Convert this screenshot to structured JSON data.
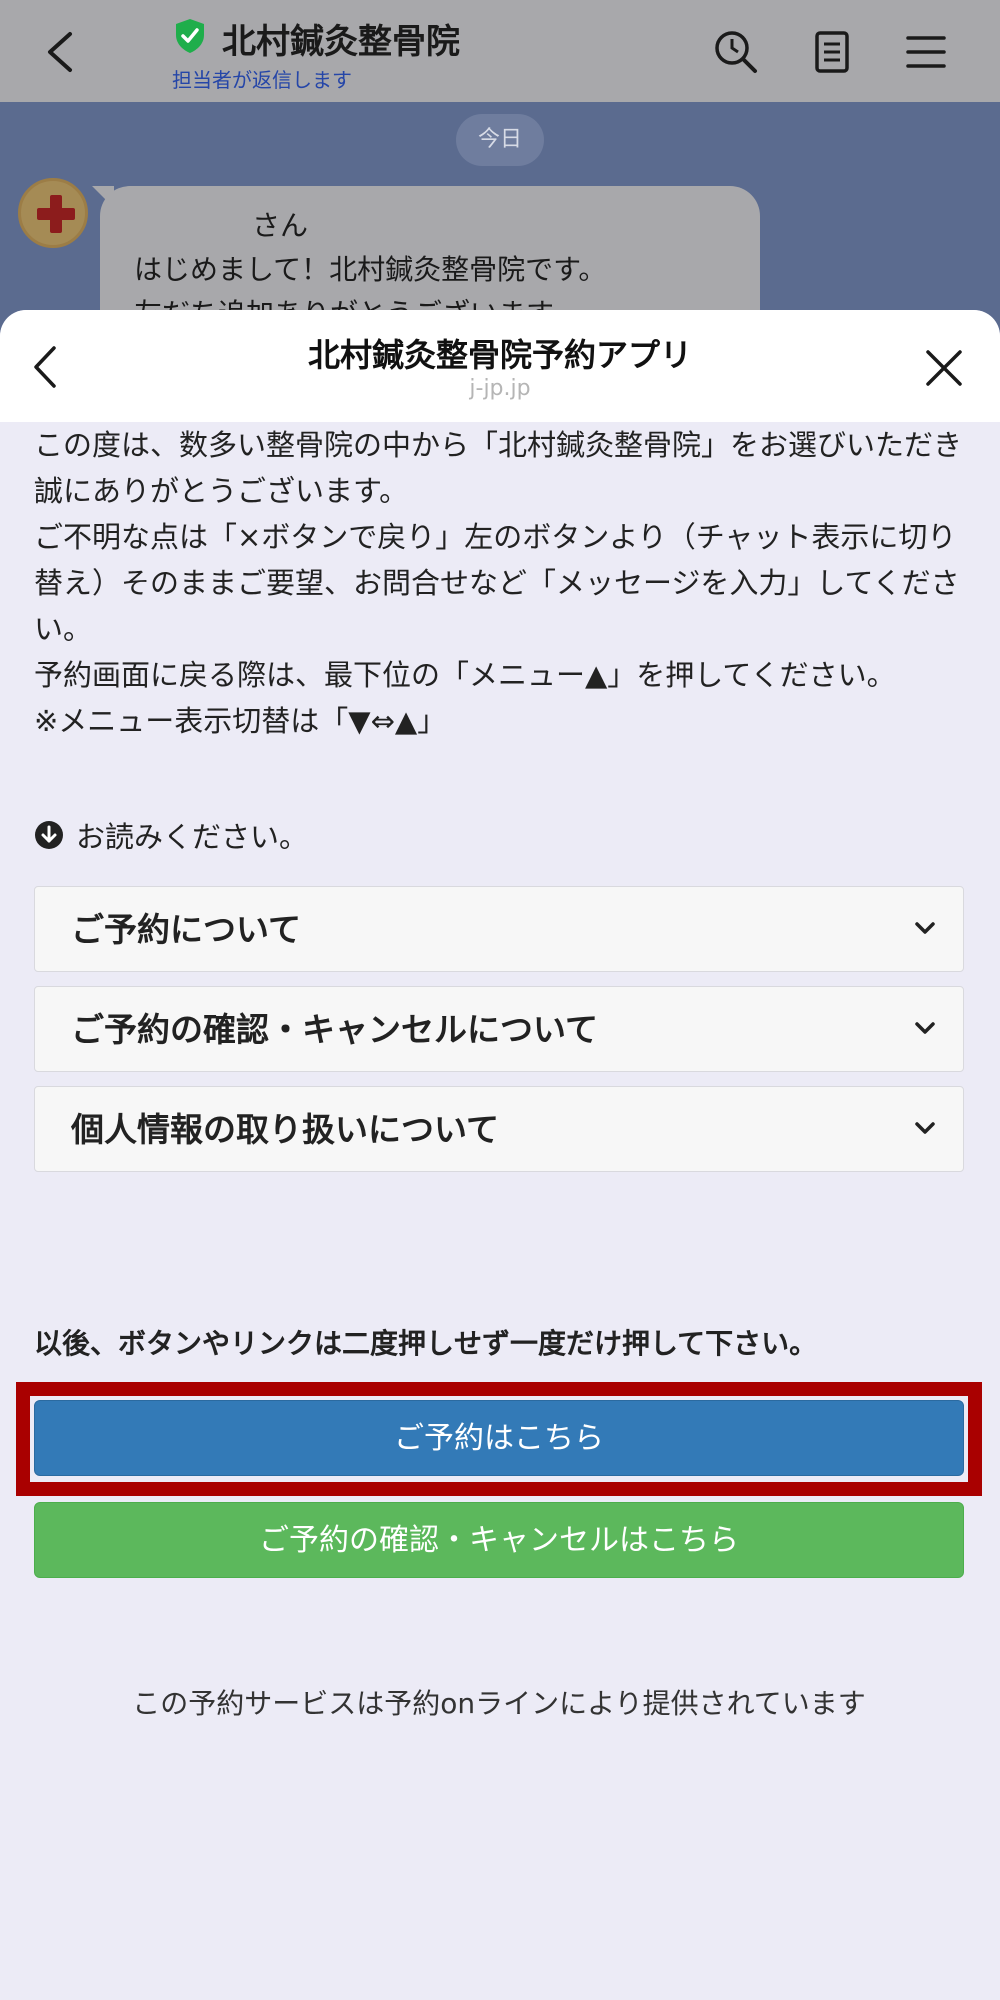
{
  "chat": {
    "title": "北村鍼灸整骨院",
    "subtitle": "担当者が返信します",
    "date_chip": "今日",
    "bubble": {
      "line1": "さん",
      "line2": "はじめまして！北村鍼灸整骨院です。",
      "line3": "友だち追加ありがとうございます。"
    }
  },
  "sheet": {
    "title": "北村鍼灸整骨院予約アプリ",
    "domain": "j-jp.jp"
  },
  "intro": {
    "p1": "この度は、数多い整骨院の中から「北村鍼灸整骨院」をお選びいただき誠にありがとうございます。",
    "p2": "ご不明な点は「×ボタンで戻り」左のボタンより（チャット表示に切り替え）そのままご要望、お問合せなど「メッセージを入力」してください。",
    "p3": "予約画面に戻る際は、最下位の「メニュー▲」を押してください。",
    "p4": "※メニュー表示切替は「▼⇔▲」"
  },
  "notice": "お読みください。",
  "accordions": [
    {
      "label": "ご予約について"
    },
    {
      "label": "ご予約の確認・キャンセルについて"
    },
    {
      "label": "個人情報の取り扱いについて"
    }
  ],
  "warning": "以後、ボタンやリンクは二度押しせず一度だけ押して下さい。",
  "buttons": {
    "reserve": "ご予約はこちら",
    "confirm_cancel": "ご予約の確認・キャンセルはこちら"
  },
  "footer": "この予約サービスは予約onラインにより提供されています",
  "colors": {
    "primary": "#337ab7",
    "success": "#5cb85c",
    "highlight": "#a90000",
    "verified": "#1fae4b"
  }
}
